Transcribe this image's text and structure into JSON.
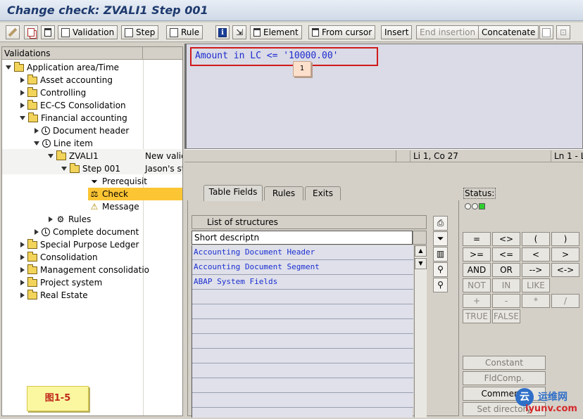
{
  "window": {
    "title": "Change check: ZVALI1 Step 001"
  },
  "toolbar": {
    "validation": "Validation",
    "step": "Step",
    "rule": "Rule",
    "element": "Element",
    "from_cursor": "From cursor",
    "insert": "Insert",
    "end_insertion": "End insertion",
    "concatenate": "Concatenate"
  },
  "tree": {
    "header": "Validations",
    "items": [
      {
        "label": "Application area/Time",
        "note": ""
      },
      {
        "label": "Asset accounting",
        "note": ""
      },
      {
        "label": "Controlling",
        "note": ""
      },
      {
        "label": "EC-CS Consolidation",
        "note": ""
      },
      {
        "label": "Financial accounting",
        "note": ""
      },
      {
        "label": "Document header",
        "note": ""
      },
      {
        "label": "Line item",
        "note": ""
      },
      {
        "label": "ZVALI1",
        "note": "New valid"
      },
      {
        "label": "Step 001",
        "note": "Jason's st"
      },
      {
        "label": "Prerequisit",
        "note": ""
      },
      {
        "label": "Check",
        "note": ""
      },
      {
        "label": "Message",
        "note": ""
      },
      {
        "label": "Rules",
        "note": ""
      },
      {
        "label": "Complete document",
        "note": ""
      },
      {
        "label": "Special Purpose Ledger",
        "note": ""
      },
      {
        "label": "Consolidation",
        "note": ""
      },
      {
        "label": "Management consolidatio",
        "note": ""
      },
      {
        "label": "Project system",
        "note": ""
      },
      {
        "label": "Real Estate",
        "note": ""
      }
    ]
  },
  "editor": {
    "code": "Amount in LC <= '10000.00'",
    "callout": "1",
    "position": "Li 1, Co 27",
    "lines": "Ln 1 - L"
  },
  "tabs": [
    "Table Fields",
    "Rules",
    "Exits"
  ],
  "list": {
    "title": "List of structures",
    "column": "Short descriptn",
    "rows": [
      "Accounting Document Header",
      "Accounting Document Segment",
      "ABAP System Fields"
    ]
  },
  "status": {
    "label": "Status:"
  },
  "operators": [
    "=",
    "<>",
    "(",
    ")",
    ">=",
    "<=",
    "<",
    ">",
    "AND",
    "OR",
    "-->",
    "<->",
    "NOT",
    "IN",
    "LIKE",
    "+",
    "-",
    "*",
    "/",
    "TRUE",
    "FALSE"
  ],
  "side_buttons": {
    "constant": "Constant",
    "fldcomp": "FldComp.",
    "comments": "Comments",
    "set_directory": "Set directory"
  },
  "figure_label": "图1-5",
  "watermark": {
    "cn": "运维网",
    "url": "iyunv.com",
    "logo": "云"
  },
  "colors": {
    "highlight": "#fcc534",
    "code_text": "#1e2ad0",
    "title_text": "#1e3a6e"
  }
}
